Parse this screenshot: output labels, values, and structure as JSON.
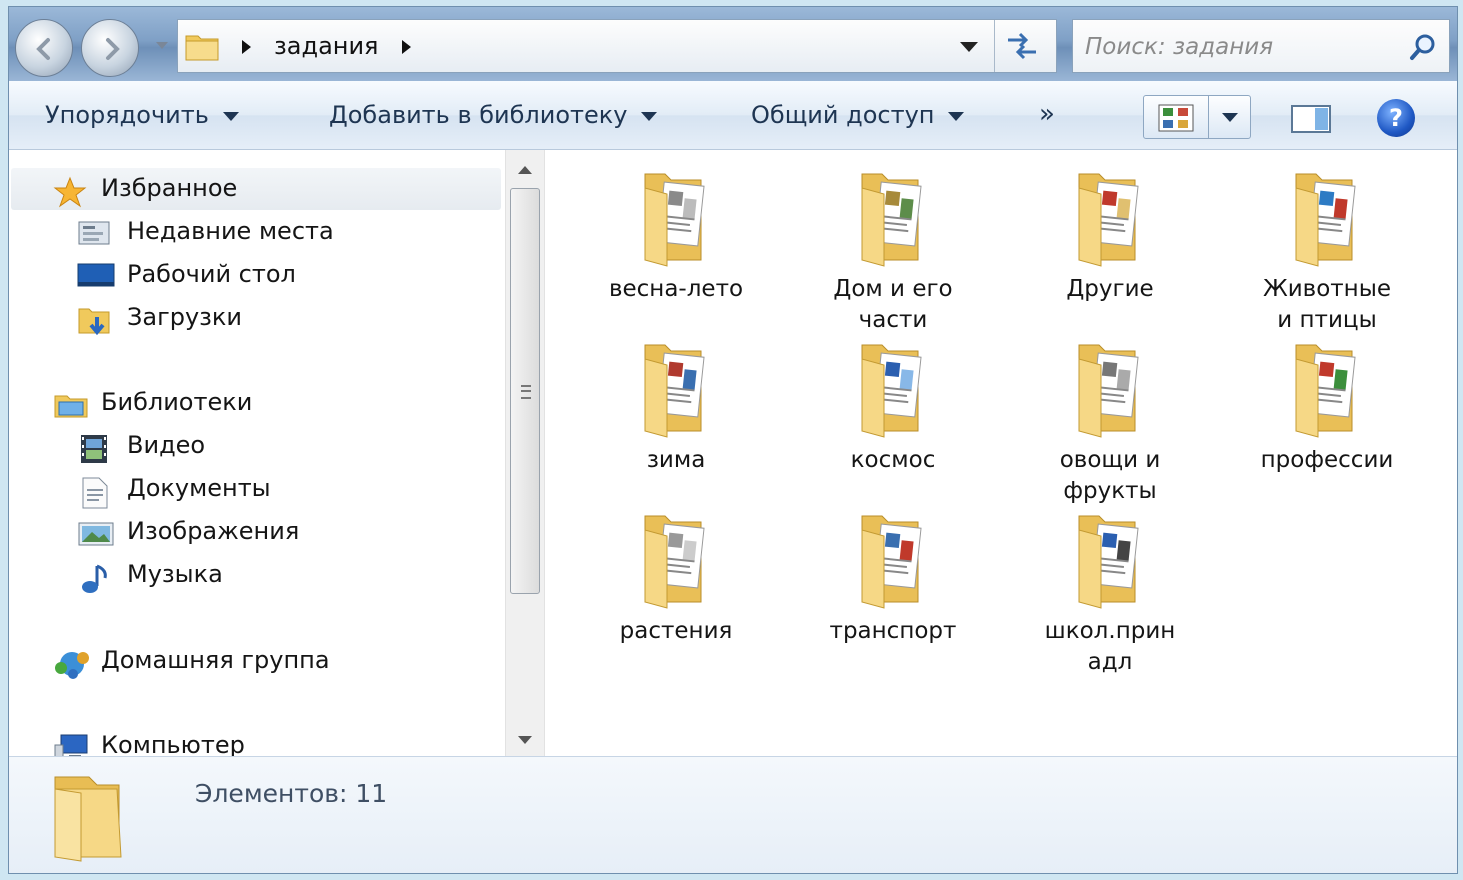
{
  "address": {
    "crumbs": [
      "задания"
    ],
    "search_placeholder": "Поиск: задания"
  },
  "toolbar": {
    "organize": "Упорядочить",
    "add_to_library": "Добавить в библиотеку",
    "share": "Общий доступ",
    "more": "»"
  },
  "nav": {
    "favorites": {
      "title": "Избранное",
      "items": [
        "Недавние места",
        "Рабочий стол",
        "Загрузки"
      ]
    },
    "libraries": {
      "title": "Библиотеки",
      "items": [
        "Видео",
        "Документы",
        "Изображения",
        "Музыка"
      ]
    },
    "homegroup": "Домашняя группа",
    "computer": "Компьютер"
  },
  "folders": [
    [
      "весна-лето"
    ],
    [
      "Дом и его",
      "части"
    ],
    [
      "Другие"
    ],
    [
      "Животные",
      "и птицы"
    ],
    [
      "зима"
    ],
    [
      "космос"
    ],
    [
      "овощи и",
      "фрукты"
    ],
    [
      "профессии"
    ],
    [
      "растения"
    ],
    [
      "транспорт"
    ],
    [
      "школ.прин",
      "адл"
    ]
  ],
  "details": {
    "count": "Элементов: 11"
  },
  "colors": {
    "folder": "#f3d27a",
    "accent": "#1e3552"
  }
}
